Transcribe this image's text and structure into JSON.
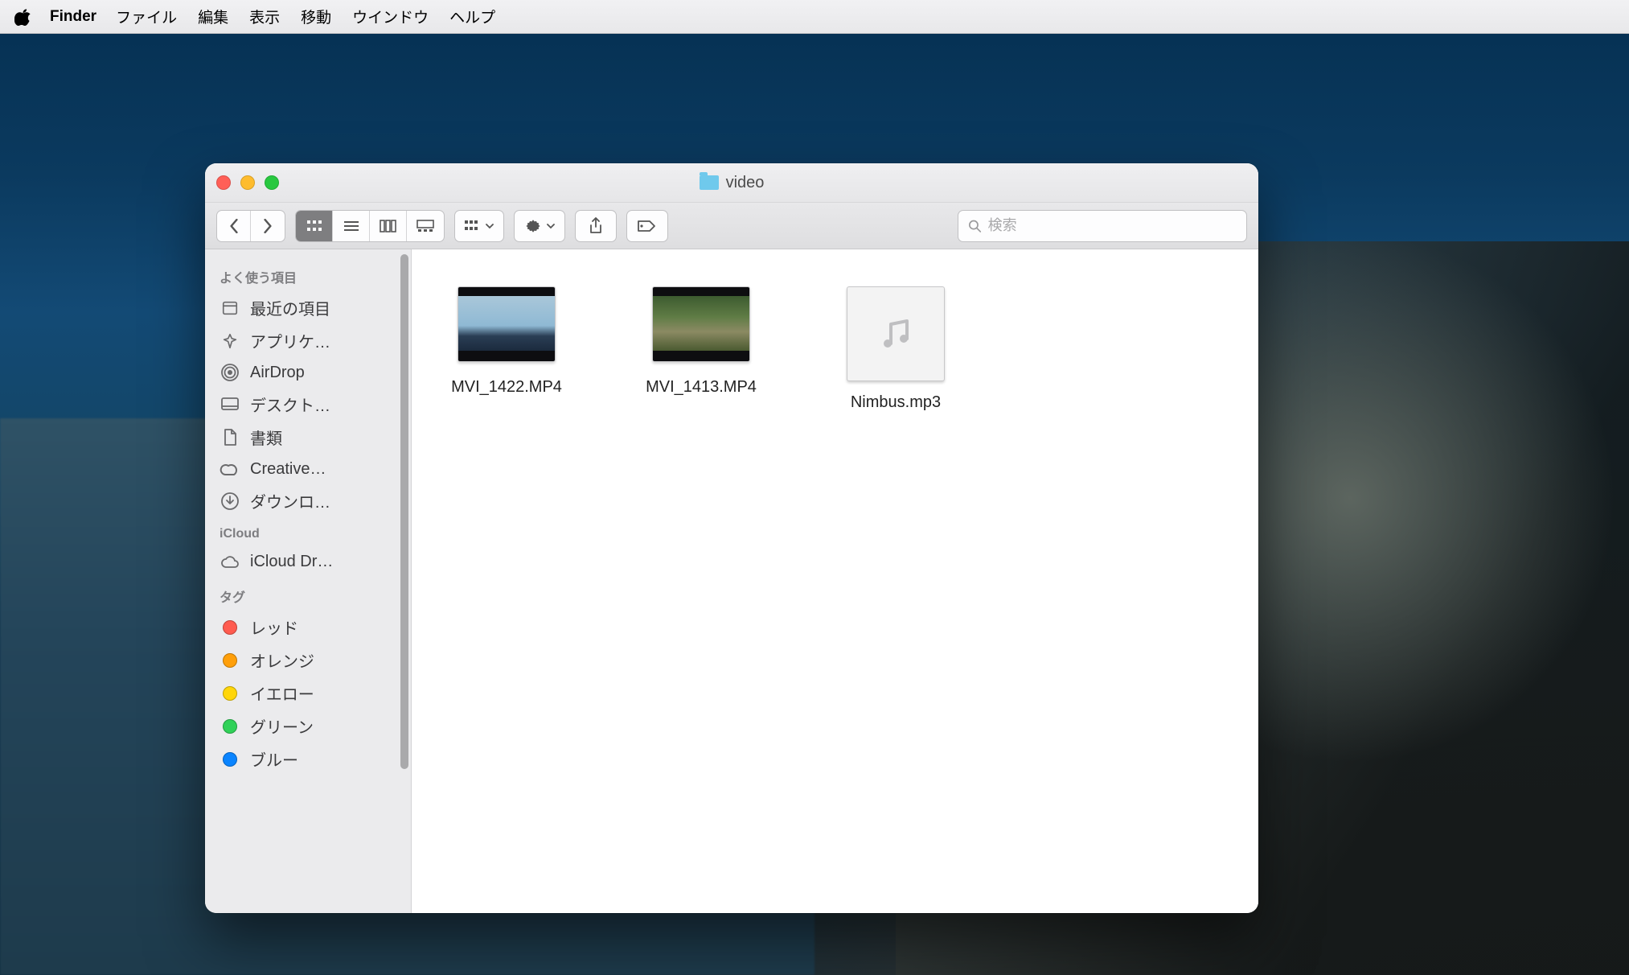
{
  "menubar": {
    "app": "Finder",
    "items": [
      "ファイル",
      "編集",
      "表示",
      "移動",
      "ウインドウ",
      "ヘルプ"
    ]
  },
  "window": {
    "title": "video"
  },
  "toolbar": {
    "search_placeholder": "検索"
  },
  "sidebar": {
    "sections": [
      {
        "header": "よく使う項目",
        "items": [
          {
            "icon": "recents",
            "label": "最近の項目"
          },
          {
            "icon": "apps",
            "label": "アプリケ…"
          },
          {
            "icon": "airdrop",
            "label": "AirDrop"
          },
          {
            "icon": "desktop",
            "label": "デスクト…"
          },
          {
            "icon": "documents",
            "label": "書類"
          },
          {
            "icon": "cloud-cc",
            "label": "Creative…"
          },
          {
            "icon": "downloads",
            "label": "ダウンロ…"
          }
        ]
      },
      {
        "header": "iCloud",
        "items": [
          {
            "icon": "cloud",
            "label": "iCloud Dr…"
          }
        ]
      },
      {
        "header": "タグ",
        "items": [
          {
            "icon": "tag",
            "color": "#ff5b4f",
            "label": "レッド"
          },
          {
            "icon": "tag",
            "color": "#ff9f0a",
            "label": "オレンジ"
          },
          {
            "icon": "tag",
            "color": "#ffd60a",
            "label": "イエロー"
          },
          {
            "icon": "tag",
            "color": "#30d158",
            "label": "グリーン"
          },
          {
            "icon": "tag",
            "color": "#0a84ff",
            "label": "ブルー"
          }
        ]
      }
    ]
  },
  "files": [
    {
      "name": "MVI_1422.MP4",
      "kind": "video1"
    },
    {
      "name": "MVI_1413.MP4",
      "kind": "video2"
    },
    {
      "name": "Nimbus.mp3",
      "kind": "audio"
    }
  ]
}
